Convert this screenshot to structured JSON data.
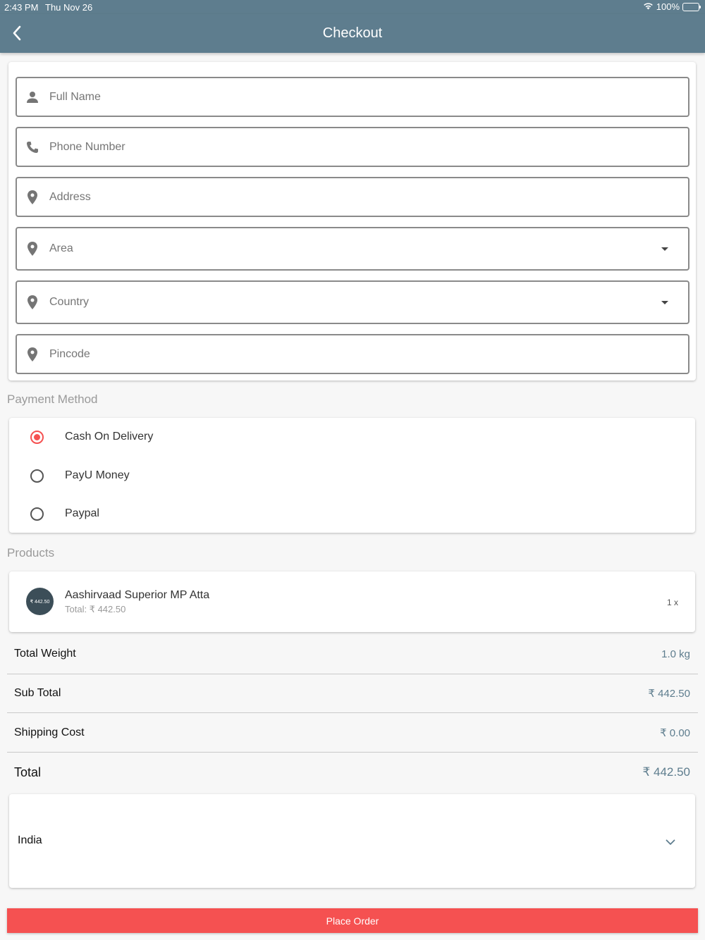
{
  "status_bar": {
    "time": "2:43 PM",
    "date": "Thu Nov 26",
    "battery": "100%"
  },
  "header": {
    "title": "Checkout"
  },
  "form": {
    "full_name": {
      "placeholder": "Full Name",
      "icon": "person-icon"
    },
    "phone": {
      "placeholder": "Phone Number",
      "icon": "phone-icon"
    },
    "address": {
      "placeholder": "Address",
      "icon": "location-pin-icon"
    },
    "area": {
      "placeholder": "Area",
      "icon": "location-pin-icon"
    },
    "country": {
      "placeholder": "Country",
      "icon": "location-pin-icon"
    },
    "pincode": {
      "placeholder": "Pincode",
      "icon": "location-pin-icon"
    }
  },
  "payment": {
    "label": "Payment Method",
    "options": [
      {
        "label": "Cash On Delivery",
        "selected": true
      },
      {
        "label": "PayU Money",
        "selected": false
      },
      {
        "label": "Paypal",
        "selected": false
      }
    ]
  },
  "products": {
    "label": "Products",
    "items": [
      {
        "badge": "₹ 442.50",
        "name": "Aashirvaad Superior MP Atta",
        "total": "Total: ₹ 442.50",
        "qty": "1 x"
      }
    ]
  },
  "summary": {
    "weight": {
      "label": "Total Weight",
      "value": "1.0 kg"
    },
    "subtotal": {
      "label": "Sub Total",
      "value": "₹ 442.50"
    },
    "shipping": {
      "label": "Shipping Cost",
      "value": "₹ 0.00"
    },
    "total": {
      "label": "Total",
      "value": "₹ 442.50"
    }
  },
  "country_select": {
    "value": "India"
  },
  "actions": {
    "place_order": "Place Order"
  },
  "colors": {
    "primary": "#5e7d8e",
    "accent": "#f55151",
    "background": "#f7f7f7"
  }
}
